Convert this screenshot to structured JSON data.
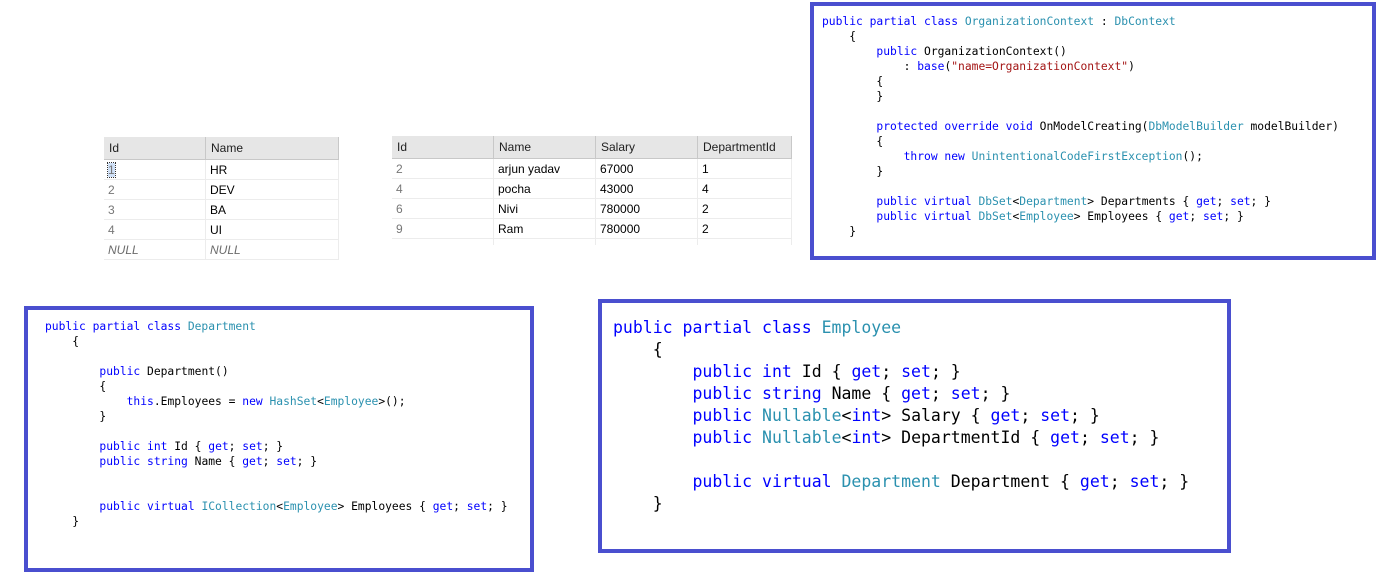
{
  "departments_grid": {
    "columns": [
      "Id",
      "Name"
    ],
    "rows": [
      {
        "id": "1",
        "name": "HR"
      },
      {
        "id": "2",
        "name": "DEV"
      },
      {
        "id": "3",
        "name": "BA"
      },
      {
        "id": "4",
        "name": "UI"
      }
    ],
    "null_row": {
      "id": "NULL",
      "name": "NULL"
    }
  },
  "employees_grid": {
    "columns": [
      "Id",
      "Name",
      "Salary",
      "DepartmentId"
    ],
    "rows": [
      {
        "id": "2",
        "name": "arjun yadav",
        "salary": "67000",
        "department_id": "1"
      },
      {
        "id": "4",
        "name": "pocha",
        "salary": "43000",
        "department_id": "4"
      },
      {
        "id": "6",
        "name": "Nivi",
        "salary": "780000",
        "department_id": "2"
      },
      {
        "id": "9",
        "name": "Ram",
        "salary": "780000",
        "department_id": "2"
      }
    ]
  },
  "colors": {
    "box_border": "#4a4fcf",
    "keyword": "#0000ff",
    "type": "#2b91af",
    "string": "#a31515"
  },
  "code": {
    "context": [
      [
        [
          "k",
          "public partial class "
        ],
        [
          "t",
          "OrganizationContext"
        ],
        [
          "p",
          " : "
        ],
        [
          "t",
          "DbContext"
        ]
      ],
      [
        [
          "p",
          "    {"
        ]
      ],
      [
        [
          "p",
          "        "
        ],
        [
          "k",
          "public "
        ],
        [
          "p",
          "OrganizationContext()"
        ]
      ],
      [
        [
          "p",
          "            : "
        ],
        [
          "k",
          "base"
        ],
        [
          "p",
          "("
        ],
        [
          "s",
          "\"name=OrganizationContext\""
        ],
        [
          "p",
          ")"
        ]
      ],
      [
        [
          "p",
          "        {"
        ]
      ],
      [
        [
          "p",
          "        }"
        ]
      ],
      [
        [
          "p",
          ""
        ]
      ],
      [
        [
          "p",
          "        "
        ],
        [
          "k",
          "protected override void "
        ],
        [
          "p",
          "OnModelCreating("
        ],
        [
          "t",
          "DbModelBuilder"
        ],
        [
          "p",
          " modelBuilder)"
        ]
      ],
      [
        [
          "p",
          "        {"
        ]
      ],
      [
        [
          "p",
          "            "
        ],
        [
          "k",
          "throw new "
        ],
        [
          "t",
          "UnintentionalCodeFirstException"
        ],
        [
          "p",
          "();"
        ]
      ],
      [
        [
          "p",
          "        }"
        ]
      ],
      [
        [
          "p",
          ""
        ]
      ],
      [
        [
          "p",
          "        "
        ],
        [
          "k",
          "public virtual "
        ],
        [
          "t",
          "DbSet"
        ],
        [
          "p",
          "<"
        ],
        [
          "t",
          "Department"
        ],
        [
          "p",
          "> Departments { "
        ],
        [
          "k",
          "get"
        ],
        [
          "p",
          "; "
        ],
        [
          "k",
          "set"
        ],
        [
          "p",
          "; }"
        ]
      ],
      [
        [
          "p",
          "        "
        ],
        [
          "k",
          "public virtual "
        ],
        [
          "t",
          "DbSet"
        ],
        [
          "p",
          "<"
        ],
        [
          "t",
          "Employee"
        ],
        [
          "p",
          "> Employees { "
        ],
        [
          "k",
          "get"
        ],
        [
          "p",
          "; "
        ],
        [
          "k",
          "set"
        ],
        [
          "p",
          "; }"
        ]
      ],
      [
        [
          "p",
          "    }"
        ]
      ]
    ],
    "department": [
      [
        [
          "k",
          "public partial class "
        ],
        [
          "t",
          "Department"
        ]
      ],
      [
        [
          "p",
          "    {"
        ]
      ],
      [
        [
          "p",
          ""
        ]
      ],
      [
        [
          "p",
          "        "
        ],
        [
          "k",
          "public "
        ],
        [
          "p",
          "Department()"
        ]
      ],
      [
        [
          "p",
          "        {"
        ]
      ],
      [
        [
          "p",
          "            "
        ],
        [
          "k",
          "this"
        ],
        [
          "p",
          ".Employees = "
        ],
        [
          "k",
          "new "
        ],
        [
          "t",
          "HashSet"
        ],
        [
          "p",
          "<"
        ],
        [
          "t",
          "Employee"
        ],
        [
          "p",
          ">();"
        ]
      ],
      [
        [
          "p",
          "        }"
        ]
      ],
      [
        [
          "p",
          ""
        ]
      ],
      [
        [
          "p",
          "        "
        ],
        [
          "k",
          "public int "
        ],
        [
          "p",
          "Id { "
        ],
        [
          "k",
          "get"
        ],
        [
          "p",
          "; "
        ],
        [
          "k",
          "set"
        ],
        [
          "p",
          "; }"
        ]
      ],
      [
        [
          "p",
          "        "
        ],
        [
          "k",
          "public string "
        ],
        [
          "p",
          "Name { "
        ],
        [
          "k",
          "get"
        ],
        [
          "p",
          "; "
        ],
        [
          "k",
          "set"
        ],
        [
          "p",
          "; }"
        ]
      ],
      [
        [
          "p",
          ""
        ]
      ],
      [
        [
          "p",
          ""
        ]
      ],
      [
        [
          "p",
          "        "
        ],
        [
          "k",
          "public virtual "
        ],
        [
          "t",
          "ICollection"
        ],
        [
          "p",
          "<"
        ],
        [
          "t",
          "Employee"
        ],
        [
          "p",
          "> Employees { "
        ],
        [
          "k",
          "get"
        ],
        [
          "p",
          "; "
        ],
        [
          "k",
          "set"
        ],
        [
          "p",
          "; }"
        ]
      ],
      [
        [
          "p",
          "    }"
        ]
      ]
    ],
    "employee": [
      [
        [
          "k",
          "public partial class "
        ],
        [
          "t",
          "Employee"
        ]
      ],
      [
        [
          "p",
          "    {"
        ]
      ],
      [
        [
          "p",
          "        "
        ],
        [
          "k",
          "public int "
        ],
        [
          "p",
          "Id { "
        ],
        [
          "k",
          "get"
        ],
        [
          "p",
          "; "
        ],
        [
          "k",
          "set"
        ],
        [
          "p",
          "; }"
        ]
      ],
      [
        [
          "p",
          "        "
        ],
        [
          "k",
          "public string "
        ],
        [
          "p",
          "Name { "
        ],
        [
          "k",
          "get"
        ],
        [
          "p",
          "; "
        ],
        [
          "k",
          "set"
        ],
        [
          "p",
          "; }"
        ]
      ],
      [
        [
          "p",
          "        "
        ],
        [
          "k",
          "public "
        ],
        [
          "t",
          "Nullable"
        ],
        [
          "p",
          "<"
        ],
        [
          "k",
          "int"
        ],
        [
          "p",
          "> Salary { "
        ],
        [
          "k",
          "get"
        ],
        [
          "p",
          "; "
        ],
        [
          "k",
          "set"
        ],
        [
          "p",
          "; }"
        ]
      ],
      [
        [
          "p",
          "        "
        ],
        [
          "k",
          "public "
        ],
        [
          "t",
          "Nullable"
        ],
        [
          "p",
          "<"
        ],
        [
          "k",
          "int"
        ],
        [
          "p",
          "> DepartmentId { "
        ],
        [
          "k",
          "get"
        ],
        [
          "p",
          "; "
        ],
        [
          "k",
          "set"
        ],
        [
          "p",
          "; }"
        ]
      ],
      [
        [
          "p",
          ""
        ]
      ],
      [
        [
          "p",
          "        "
        ],
        [
          "k",
          "public virtual "
        ],
        [
          "t",
          "Department"
        ],
        [
          "p",
          " Department { "
        ],
        [
          "k",
          "get"
        ],
        [
          "p",
          "; "
        ],
        [
          "k",
          "set"
        ],
        [
          "p",
          "; }"
        ]
      ],
      [
        [
          "p",
          "    }"
        ]
      ]
    ]
  }
}
